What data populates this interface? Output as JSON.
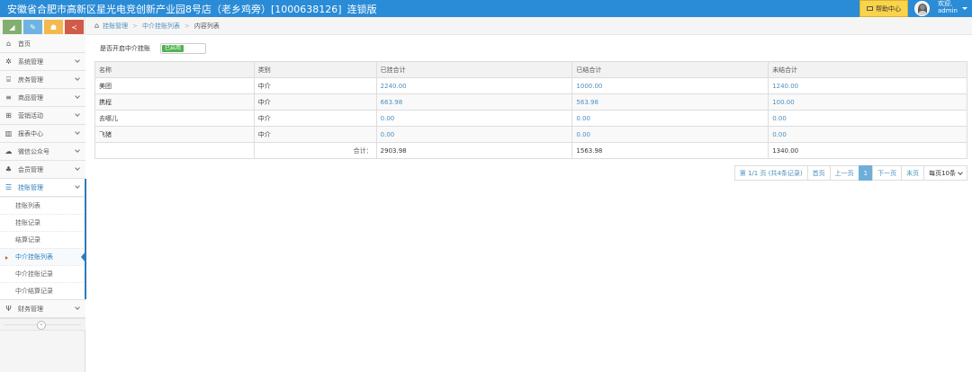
{
  "header": {
    "store_title": "安徽省合肥市高新区星光电竞创新产业园8号店（老乡鸡旁）[1000638126]",
    "edition": "连锁版",
    "help_label": "帮助中心",
    "welcome_text": "欢迎,",
    "username": "admin",
    "bg_color": "#2a8bd6",
    "help_color": "#f9d34a"
  },
  "sidebar": {
    "shortcuts": [
      {
        "icon": "chart-icon",
        "glyph": "◢",
        "color": "#82af6f"
      },
      {
        "icon": "pencil-icon",
        "glyph": "✎",
        "color": "#6fb3e0"
      },
      {
        "icon": "users-icon",
        "glyph": "☗",
        "color": "#f2b94e"
      },
      {
        "icon": "share-icon",
        "glyph": "≺",
        "color": "#d15b47"
      }
    ],
    "items": [
      {
        "label": "首页",
        "icon": "home-icon",
        "glyph": "⌂"
      },
      {
        "label": "系统管理",
        "icon": "gear-icon",
        "glyph": "✲"
      },
      {
        "label": "房务管理",
        "icon": "bank-icon",
        "glyph": "⌸"
      },
      {
        "label": "商品管理",
        "icon": "database-icon",
        "glyph": "≡"
      },
      {
        "label": "营销活动",
        "icon": "gift-icon",
        "glyph": "⊞"
      },
      {
        "label": "报表中心",
        "icon": "bar-chart-icon",
        "glyph": "▥"
      },
      {
        "label": "微信公众号",
        "icon": "cloud-icon",
        "glyph": "☁"
      },
      {
        "label": "会员管理",
        "icon": "group-icon",
        "glyph": "♣"
      },
      {
        "label": "挂账管理",
        "icon": "list-icon",
        "glyph": "☰"
      },
      {
        "label": "财务管理",
        "icon": "cutlery-icon",
        "glyph": "Ψ"
      }
    ],
    "submenu": [
      {
        "label": "挂账列表"
      },
      {
        "label": "挂账记录"
      },
      {
        "label": "结算记录"
      },
      {
        "label": "中介挂账列表"
      },
      {
        "label": "中介挂账记录"
      },
      {
        "label": "中介结算记录"
      }
    ],
    "collapse_glyph": "«"
  },
  "breadcrumb": {
    "items": [
      "挂账管理",
      "中介挂账列表",
      "内容列表"
    ],
    "separator": ">"
  },
  "toggle": {
    "label": "是否开启中介挂账",
    "state_label": "已启用",
    "on": true
  },
  "table": {
    "headers": [
      "名称",
      "类别",
      "已挂合计",
      "已结合计",
      "未结合计"
    ],
    "rows": [
      {
        "name": "美团",
        "type": "中介",
        "hung": "2240.00",
        "settled": "1000.00",
        "unsettled": "1240.00"
      },
      {
        "name": "携程",
        "type": "中介",
        "hung": "663.98",
        "settled": "563.98",
        "unsettled": "100.00"
      },
      {
        "name": "去哪儿",
        "type": "中介",
        "hung": "0.00",
        "settled": "0.00",
        "unsettled": "0.00"
      },
      {
        "name": "飞猪",
        "type": "中介",
        "hung": "0.00",
        "settled": "0.00",
        "unsettled": "0.00"
      }
    ],
    "total": {
      "label": "合计：",
      "hung": "2903.98",
      "settled": "1563.98",
      "unsettled": "1340.00"
    }
  },
  "pager": {
    "info": "第 1/1 页 (共4条记录)",
    "first": "首页",
    "prev": "上一页",
    "current": "1",
    "next": "下一页",
    "last": "末页",
    "page_size": "每页10条"
  }
}
